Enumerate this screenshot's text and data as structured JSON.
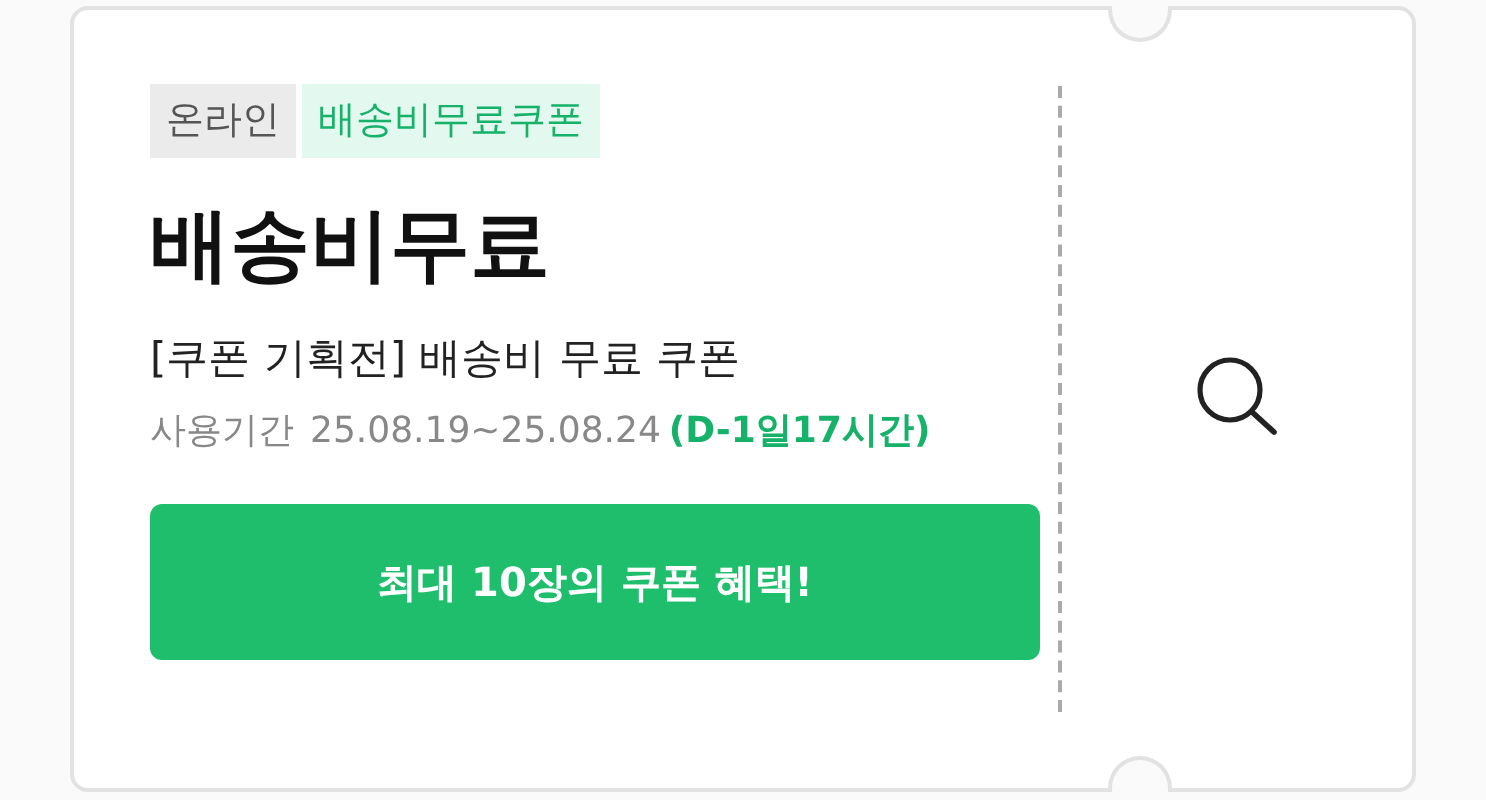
{
  "tags": [
    {
      "label": "온라인",
      "kind": "channel"
    },
    {
      "label": "배송비무료쿠폰",
      "kind": "benefit"
    }
  ],
  "title": "배송비무료",
  "subtitle": "[쿠폰 기획전] 배송비 무료 쿠폰",
  "period": {
    "label": "사용기간",
    "dates": "25.08.19~25.08.24",
    "remaining": "(D-1일17시간)"
  },
  "button": "최대 10장의 쿠폰 혜택!"
}
